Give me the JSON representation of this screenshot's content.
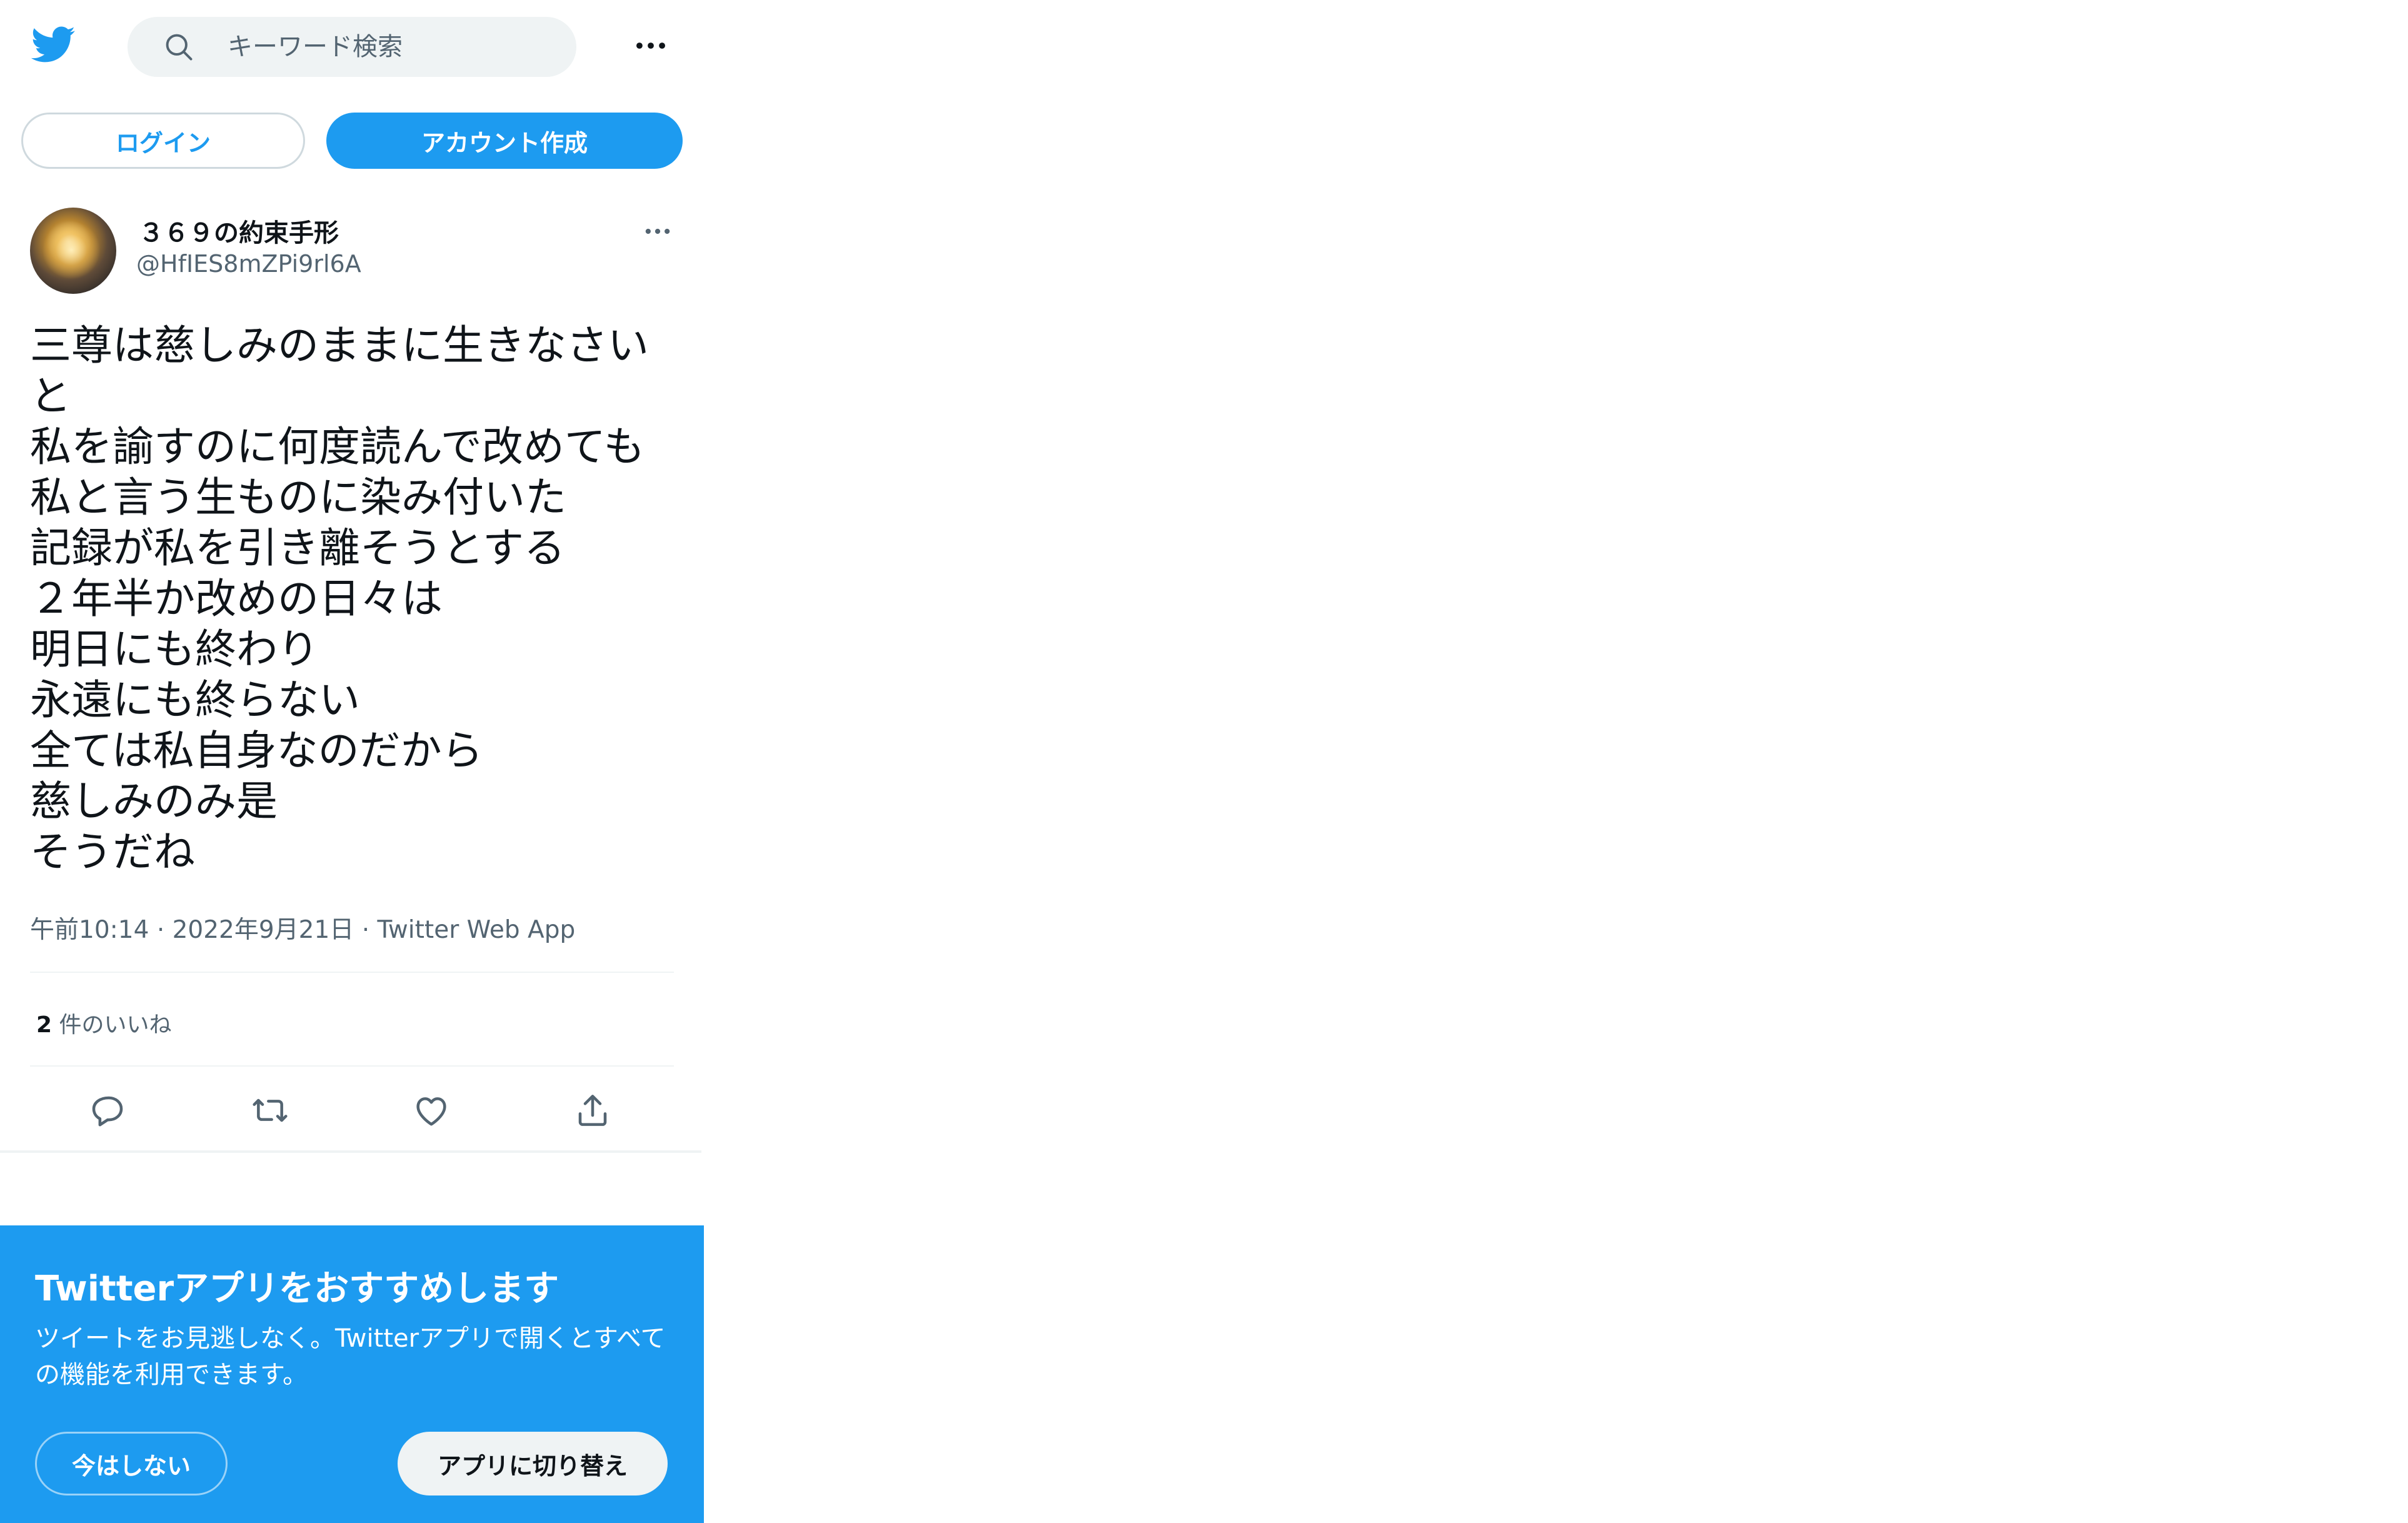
{
  "header": {
    "search_placeholder": "キーワード検索"
  },
  "auth": {
    "login_label": "ログイン",
    "signup_label": "アカウント作成"
  },
  "tweet": {
    "author_name": "３６９の約束手形",
    "author_handle": "@HfIES8mZPi9rl6A",
    "text_lines": [
      "三尊は慈しみのままに生きなさい",
      "と",
      "私を諭すのに何度読んで改めても",
      "私と言う生ものに染み付いた",
      "記録が私を引き離そうとする",
      "２年半か改めの日々は",
      "明日にも終わり",
      "永遠にも終らない",
      "全ては私自身なのだから",
      "慈しみのみ是",
      "そうだね"
    ],
    "time": "午前10:14",
    "date": "2022年9月21日",
    "source": "Twitter Web App",
    "likes_count": "2",
    "likes_label": "件のいいね"
  },
  "banner": {
    "title": "Twitterアプリをおすすめします",
    "body": "ツイートをお見逃しなく。Twitterアプリで開くとすべての機能を利用できます。",
    "not_now_label": "今はしない",
    "switch_label": "アプリに切り替え"
  },
  "icons": {
    "logo": "twitter-bird-icon",
    "search": "search-icon",
    "more": "more-horizontal-icon",
    "reply": "reply-icon",
    "retweet": "retweet-icon",
    "like": "like-heart-icon",
    "share": "share-icon"
  },
  "colors": {
    "brand": "#1d9bf0",
    "text_primary": "#0f1419",
    "text_secondary": "#536471",
    "search_bg": "#eff3f4"
  }
}
